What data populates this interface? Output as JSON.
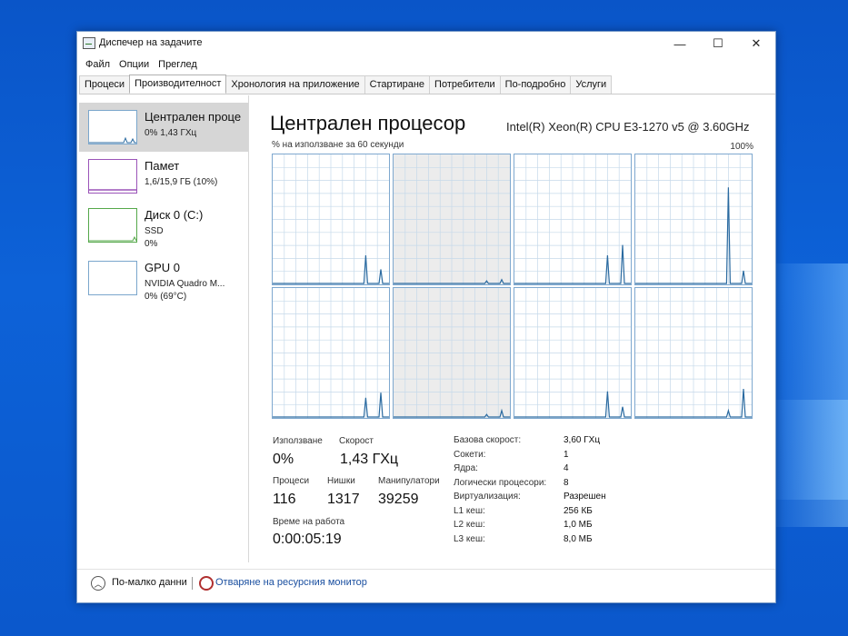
{
  "window": {
    "title": "Диспечер на задачите",
    "buttons": {
      "minimize": "—",
      "maximize": "☐",
      "close": "✕"
    }
  },
  "menu": [
    "Файл",
    "Опции",
    "Преглед"
  ],
  "tabs": [
    {
      "label": "Процеси",
      "active": false
    },
    {
      "label": "Производителност",
      "active": true
    },
    {
      "label": "Хронология на приложение",
      "active": false
    },
    {
      "label": "Стартиране",
      "active": false
    },
    {
      "label": "Потребители",
      "active": false
    },
    {
      "label": "По-подробно",
      "active": false
    },
    {
      "label": "Услуги",
      "active": false
    }
  ],
  "sidebar": {
    "cpu": {
      "title": "Централен проце",
      "line1": "0% 1,43 ГХц"
    },
    "memory": {
      "title": "Памет",
      "line1": "1,6/15,9 ГБ (10%)"
    },
    "disk": {
      "title": "Диск 0 (C:)",
      "line1": "SSD",
      "line2": "0%"
    },
    "gpu": {
      "title": "GPU 0",
      "line1": "NVIDIA Quadro M...",
      "line2": "0% (69°C)"
    }
  },
  "main": {
    "title": "Централен процесор",
    "model": "Intel(R) Xeon(R) CPU E3-1270 v5 @ 3.60GHz",
    "utilization_label": "% на използване за 60 секунди",
    "max_label": "100%"
  },
  "cpu_cores": [
    {
      "spikes": [
        [
          0.8,
          0.22
        ],
        [
          0.93,
          0.11
        ]
      ]
    },
    {
      "spikes": [
        [
          0.8,
          0.02
        ],
        [
          0.93,
          0.03
        ]
      ]
    },
    {
      "spikes": [
        [
          0.8,
          0.22
        ],
        [
          0.93,
          0.3
        ]
      ]
    },
    {
      "spikes": [
        [
          0.8,
          0.75
        ],
        [
          0.93,
          0.1
        ]
      ]
    },
    {
      "spikes": [
        [
          0.8,
          0.15
        ],
        [
          0.93,
          0.19
        ]
      ]
    },
    {
      "spikes": [
        [
          0.8,
          0.02
        ],
        [
          0.93,
          0.05
        ]
      ]
    },
    {
      "spikes": [
        [
          0.8,
          0.2
        ],
        [
          0.93,
          0.08
        ]
      ]
    },
    {
      "spikes": [
        [
          0.8,
          0.05
        ],
        [
          0.93,
          0.22
        ]
      ]
    }
  ],
  "stats": {
    "utilization": {
      "label": "Използване",
      "value": "0%"
    },
    "speed": {
      "label": "Скорост",
      "value": "1,43 ГХц"
    },
    "processes": {
      "label": "Процеси",
      "value": "116"
    },
    "threads": {
      "label": "Нишки",
      "value": "1317"
    },
    "handles": {
      "label": "Манипулатори",
      "value": "39259"
    },
    "uptime": {
      "label": "Време на работа",
      "value": "0:00:05:19"
    }
  },
  "info": [
    {
      "key": "Базова скорост:",
      "value": "3,60 ГХц"
    },
    {
      "key": "Сокети:",
      "value": "1"
    },
    {
      "key": "Ядра:",
      "value": "4"
    },
    {
      "key": "Логически процесори:",
      "value": "8"
    },
    {
      "key": "Виртуализация:",
      "value": "Разрешен"
    },
    {
      "key": "L1 кеш:",
      "value": "256 КБ"
    },
    {
      "key": "L2 кеш:",
      "value": "1,0 МБ"
    },
    {
      "key": "L3 кеш:",
      "value": "8,0 МБ"
    }
  ],
  "footer": {
    "fewer_details": "По-малко данни",
    "resource_monitor": "Отваряне на ресурсния монитор"
  },
  "colors": {
    "graph_line": "#2a6aa0",
    "graph_border": "#7ea8cf",
    "grid_line": "#c6d9ea"
  }
}
